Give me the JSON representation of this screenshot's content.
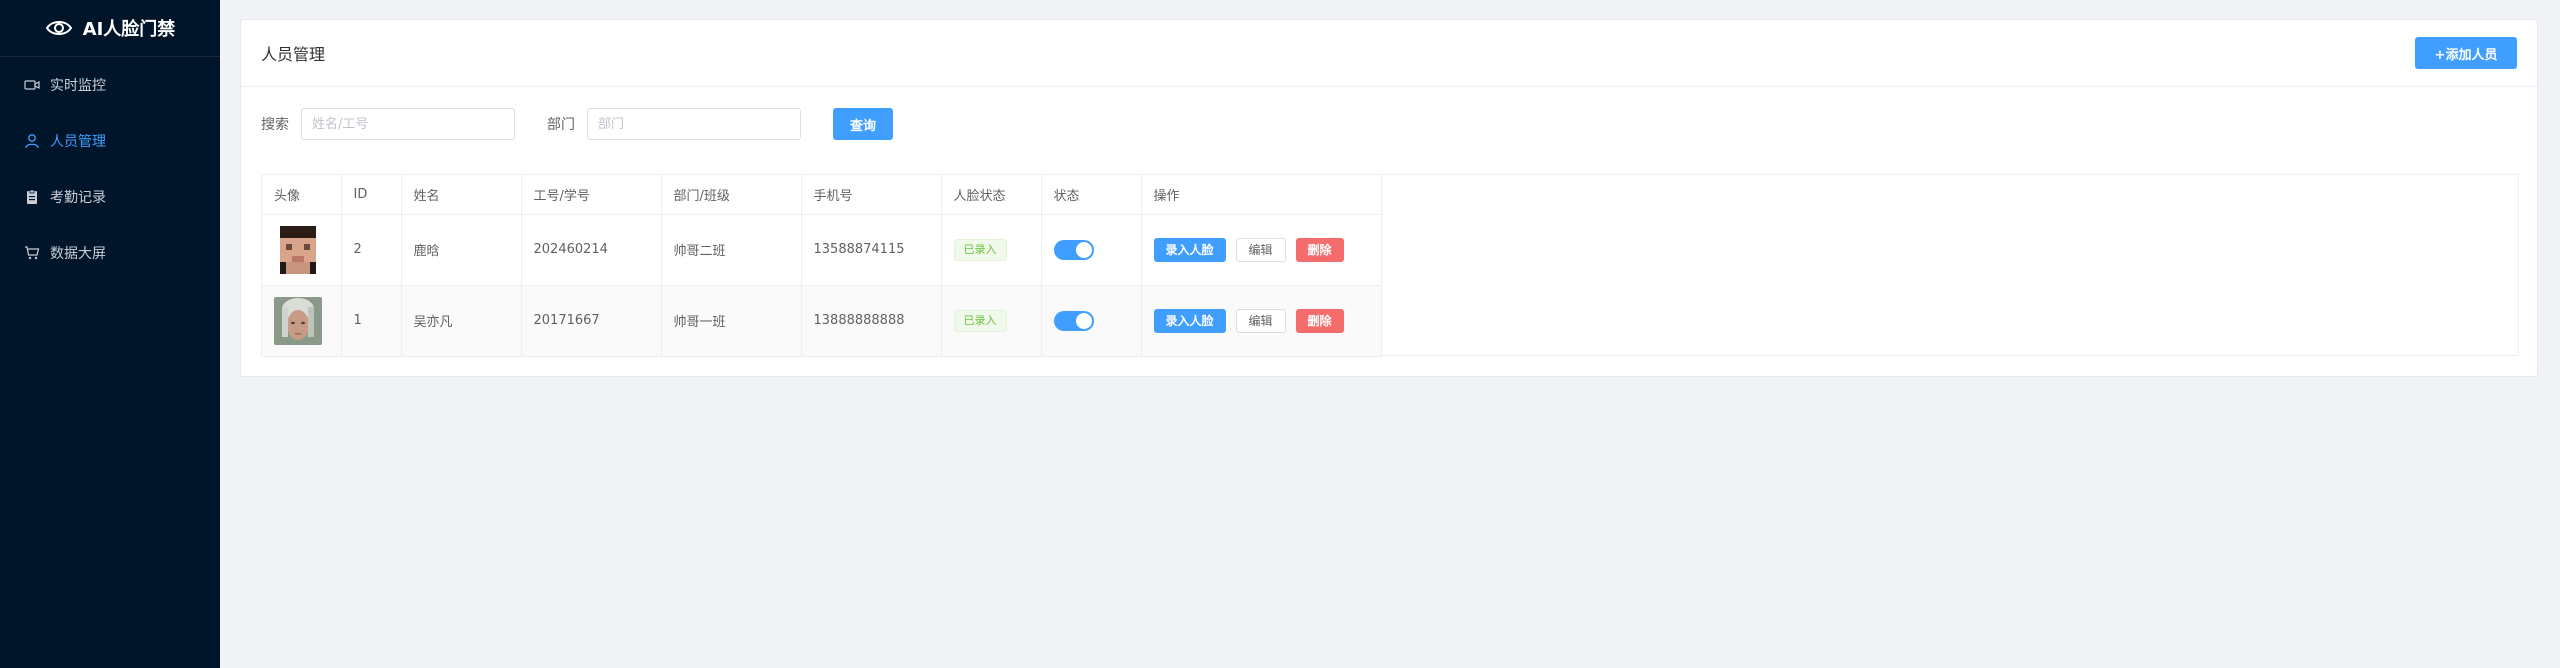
{
  "app": {
    "title": "AI人脸门禁"
  },
  "sidebar": {
    "items": [
      {
        "label": "实时监控",
        "icon": "video-camera-icon",
        "active": false
      },
      {
        "label": "人员管理",
        "icon": "user-icon",
        "active": true
      },
      {
        "label": "考勤记录",
        "icon": "clipboard-icon",
        "active": false
      },
      {
        "label": "数据大屏",
        "icon": "monitor-icon",
        "active": false
      }
    ]
  },
  "main": {
    "title": "人员管理",
    "add_button": "+添加人员",
    "search": {
      "label": "搜索",
      "placeholder": "姓名/工号",
      "dept_label": "部门",
      "dept_placeholder": "部门",
      "query_button": "查询"
    },
    "table": {
      "columns": [
        "头像",
        "ID",
        "姓名",
        "工号/学号",
        "部门/班级",
        "手机号",
        "人脸状态",
        "状态",
        "操作"
      ],
      "rows": [
        {
          "id": "2",
          "name": "鹿晗",
          "number": "202460214",
          "dept": "帅哥二班",
          "phone": "13588874115",
          "face_status": "已录入",
          "enabled": true
        },
        {
          "id": "1",
          "name": "吴亦凡",
          "number": "20171667",
          "dept": "帅哥一班",
          "phone": "13888888888",
          "face_status": "已录入",
          "enabled": true
        }
      ],
      "actions": {
        "enroll": "录入人脸",
        "edit": "编辑",
        "delete": "删除"
      }
    }
  },
  "colors": {
    "sidebar_bg": "#001529",
    "primary": "#409eff",
    "danger": "#f56c6c",
    "success": "#67c23a"
  }
}
